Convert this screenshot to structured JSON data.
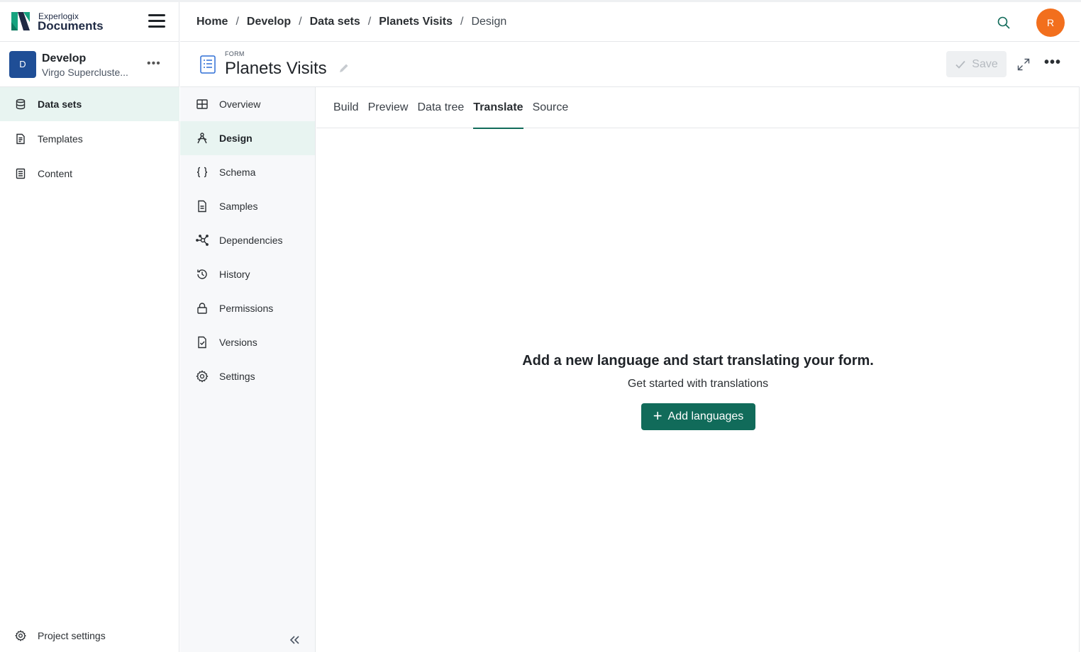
{
  "brand": {
    "small": "Experlogix",
    "big": "Documents"
  },
  "project": {
    "initial": "D",
    "name": "Develop",
    "subtitle": "Virgo Superclust­e..."
  },
  "sidebar": {
    "items": [
      {
        "label": "Data sets",
        "icon": "database-icon",
        "active": true
      },
      {
        "label": "Templates",
        "icon": "template-doc-icon",
        "active": false
      },
      {
        "label": "Content",
        "icon": "content-icon",
        "active": false
      }
    ],
    "project_settings": "Project settings"
  },
  "breadcrumb": [
    "Home",
    "Develop",
    "Data sets",
    "Planets Visits",
    "Design"
  ],
  "user": {
    "initial": "R",
    "color": "#f26f1d"
  },
  "form": {
    "kicker": "FORM",
    "title": "Planets Visits",
    "save_label": "Save"
  },
  "subnav": {
    "items": [
      {
        "label": "Overview",
        "icon": "grid-icon"
      },
      {
        "label": "Design",
        "icon": "design-icon",
        "active": true
      },
      {
        "label": "Schema",
        "icon": "braces-icon"
      },
      {
        "label": "Samples",
        "icon": "document-icon"
      },
      {
        "label": "Dependencies",
        "icon": "network-icon"
      },
      {
        "label": "History",
        "icon": "history-icon"
      },
      {
        "label": "Permissions",
        "icon": "lock-icon"
      },
      {
        "label": "Versions",
        "icon": "file-check-icon"
      },
      {
        "label": "Settings",
        "icon": "gear-icon"
      }
    ]
  },
  "tabs": [
    {
      "label": "Build"
    },
    {
      "label": "Preview"
    },
    {
      "label": "Data tree"
    },
    {
      "label": "Translate",
      "active": true
    },
    {
      "label": "Source"
    }
  ],
  "empty_state": {
    "title": "Add a new language and start translating your form.",
    "subtitle": "Get started with translations",
    "button_label": "Add languages"
  },
  "colors": {
    "accent": "#116b5a",
    "active_bg": "#e8f4f1",
    "project_avatar": "#1f4e96"
  }
}
